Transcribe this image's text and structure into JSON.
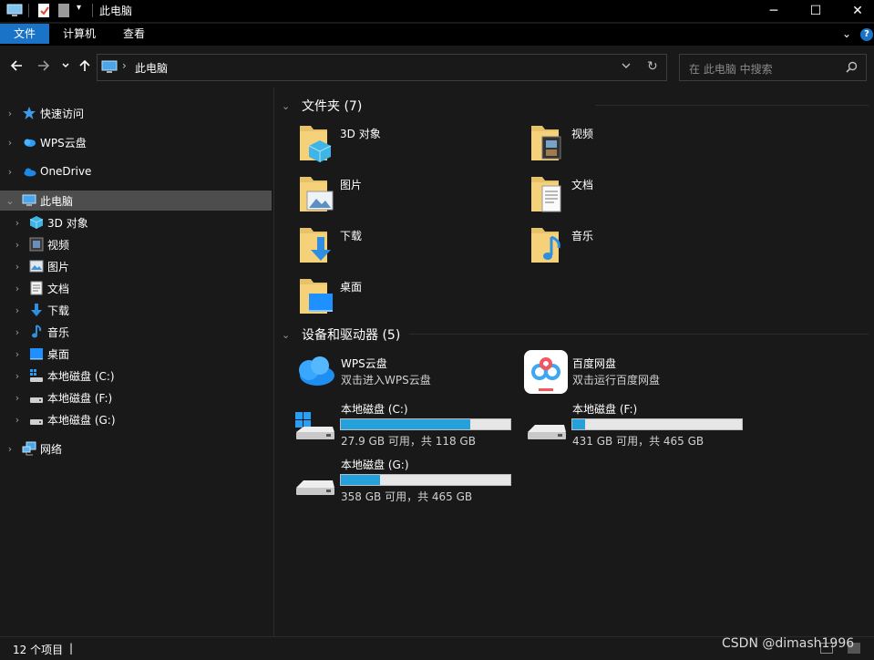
{
  "window": {
    "title": "此电脑",
    "controls": {
      "minimize": "─",
      "maximize": "☐",
      "close": "✕"
    }
  },
  "ribbon": {
    "tabs": [
      {
        "label": "文件",
        "active": true
      },
      {
        "label": "计算机",
        "active": false
      },
      {
        "label": "查看",
        "active": false
      }
    ],
    "help": "?"
  },
  "nav": {
    "address": "此电脑",
    "search_placeholder": "在 此电脑 中搜索"
  },
  "sidebar": {
    "items": [
      {
        "label": "快速访问",
        "icon": "star-icon"
      },
      {
        "label": "WPS云盘",
        "icon": "cloud-icon"
      },
      {
        "label": "OneDrive",
        "icon": "onedrive-icon"
      },
      {
        "label": "此电脑",
        "icon": "computer-icon",
        "selected": true
      },
      {
        "label": "3D 对象",
        "icon": "cube-icon"
      },
      {
        "label": "视频",
        "icon": "video-icon"
      },
      {
        "label": "图片",
        "icon": "picture-icon"
      },
      {
        "label": "文档",
        "icon": "document-icon"
      },
      {
        "label": "下载",
        "icon": "download-icon"
      },
      {
        "label": "音乐",
        "icon": "music-icon"
      },
      {
        "label": "桌面",
        "icon": "desktop-icon"
      },
      {
        "label": "本地磁盘 (C:)",
        "icon": "drive-icon"
      },
      {
        "label": "本地磁盘 (F:)",
        "icon": "drive-icon"
      },
      {
        "label": "本地磁盘 (G:)",
        "icon": "drive-icon"
      },
      {
        "label": "网络",
        "icon": "network-icon"
      }
    ]
  },
  "folders": {
    "header": "文件夹 (7)",
    "items": [
      {
        "label": "3D 对象",
        "icon": "cube-icon"
      },
      {
        "label": "视频",
        "icon": "video-icon"
      },
      {
        "label": "图片",
        "icon": "picture-icon"
      },
      {
        "label": "文档",
        "icon": "document-icon"
      },
      {
        "label": "下载",
        "icon": "download-icon"
      },
      {
        "label": "音乐",
        "icon": "music-icon"
      },
      {
        "label": "桌面",
        "icon": "desktop-icon"
      }
    ]
  },
  "devices": {
    "header": "设备和驱动器 (5)",
    "apps": [
      {
        "name": "WPS云盘",
        "sub": "双击进入WPS云盘",
        "icon": "wps-cloud-icon"
      },
      {
        "name": "百度网盘",
        "sub": "双击运行百度网盘",
        "icon": "baidu-netdisk-icon"
      }
    ],
    "drives": [
      {
        "name": "本地磁盘 (C:)",
        "sub": "27.9 GB 可用，共 118 GB",
        "used_fraction": 0.764,
        "icon": "windows-drive-icon"
      },
      {
        "name": "本地磁盘 (F:)",
        "sub": "431 GB 可用，共 465 GB",
        "used_fraction": 0.073,
        "icon": "drive-icon"
      },
      {
        "name": "本地磁盘 (G:)",
        "sub": "358 GB 可用，共 465 GB",
        "used_fraction": 0.23,
        "icon": "drive-icon"
      }
    ]
  },
  "status": {
    "count": "12 个项目",
    "separator": "|"
  },
  "watermark": "CSDN @dimash1996",
  "colors": {
    "accent": "#1a73c7",
    "bar_fill": "#26a0da",
    "selection": "#4d4d4d",
    "background": "#191919"
  }
}
